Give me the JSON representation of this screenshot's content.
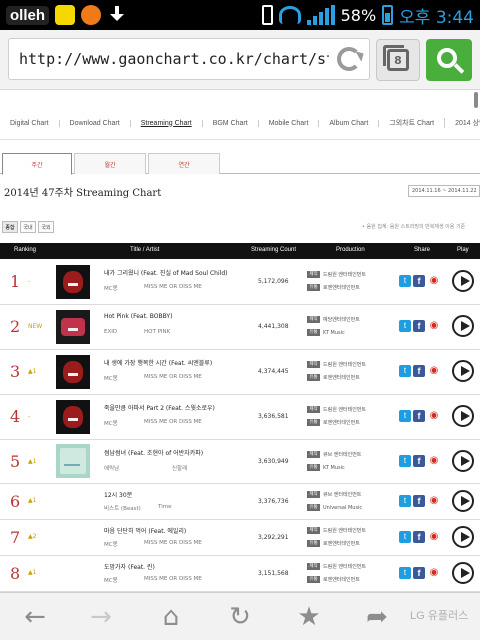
{
  "status_bar": {
    "carrier": "olleh",
    "battery_percent": "58%",
    "time": "오후 3:44"
  },
  "browser": {
    "url": "http://www.gaonchart.co.kr/chart/str...",
    "tab_count": "8"
  },
  "site_nav": {
    "items": [
      "Digital Chart",
      "Download Chart",
      "Streaming Chart",
      "BGM Chart",
      "Mobile Chart",
      "Album Chart",
      "그외차트 Chart",
      "2014 상반기"
    ],
    "active_index": 2
  },
  "period_tabs": [
    "주간",
    "월간",
    "연간"
  ],
  "chart_title": "2014년 47주차 Streaming Chart",
  "date_range": "2014.11.16 ~ 2014.11.22",
  "filters": [
    "종합",
    "국내",
    "국외"
  ],
  "note": "• 음원 집계: 음원 스트리밍의 반복재생 이용 기준",
  "table_headers": {
    "ranking": "Ranking",
    "title_artist": "Title / Artist",
    "count": "Streaming Count",
    "production": "Production",
    "share": "Share",
    "play": "Play"
  },
  "tags": {
    "making": "제작",
    "distribution": "유통"
  },
  "rows": [
    {
      "rank": "1",
      "change": "-",
      "title": "내가 그리웠니 (Feat. 진실 of Mad Soul Child)",
      "artist": "MC몽",
      "album": "MISS ME OR DISS ME",
      "count": "5,172,096",
      "maker": "드림원 엔터테인먼트",
      "distributor": "로엔엔터테인먼트"
    },
    {
      "rank": "2",
      "change": "NEW",
      "title": "Hot Pink (Feat. BOBBY)",
      "artist": "EXID",
      "album": "HOT PINK",
      "count": "4,441,308",
      "maker": "예당엔터테인먼트",
      "distributor": "KT Music"
    },
    {
      "rank": "3",
      "change": "▲1",
      "title": "내 생에 가장 행복한 시간 (Feat. 씨엔블루)",
      "artist": "MC몽",
      "album": "MISS ME OR DISS ME",
      "count": "4,374,445",
      "maker": "드림원 엔터테인먼트",
      "distributor": "로엔엔터테인먼트"
    },
    {
      "rank": "4",
      "change": "-",
      "title": "죽을만큼 아파서 Part 2 (Feat. 스윗소로우)",
      "artist": "MC몽",
      "album": "MISS ME OR DISS ME",
      "count": "3,636,581",
      "maker": "드림원 엔터테인먼트",
      "distributor": "로엔엔터테인먼트"
    },
    {
      "rank": "5",
      "change": "▲1",
      "title": "썸남썸녀 (Feat. 조현아 of 어반자카파)",
      "artist": "에릭남",
      "album": "신할래",
      "count": "3,630,949",
      "maker": "큐브 엔터테인먼트",
      "distributor": "KT Music"
    },
    {
      "rank": "6",
      "change": "▲1",
      "title": "12시 30분",
      "artist": "비스트 (Beast)",
      "album": "Time",
      "count": "3,376,736",
      "maker": "큐브 엔터테인먼트",
      "distributor": "Universal Music"
    },
    {
      "rank": "7",
      "change": "▲2",
      "title": "마음 단단히 먹어 (Feat. 에일리)",
      "artist": "MC몽",
      "album": "MISS ME OR DISS ME",
      "count": "3,292,291",
      "maker": "드림원 엔터테인먼트",
      "distributor": "로엔엔터테인먼트"
    },
    {
      "rank": "8",
      "change": "▲1",
      "title": "도망가자 (Feat. 린)",
      "artist": "MC몽",
      "album": "MISS ME OR DISS ME",
      "count": "3,151,568",
      "maker": "드림원 엔터테인먼트",
      "distributor": "로엔엔터테인먼트"
    }
  ],
  "bottom_toolbar": {
    "back_icon": "←",
    "forward_icon": "→",
    "home_icon": "⌂",
    "reload_icon": "↻",
    "bookmark_icon": "★",
    "share_icon": "➦",
    "brand": "LG 유플러스"
  }
}
